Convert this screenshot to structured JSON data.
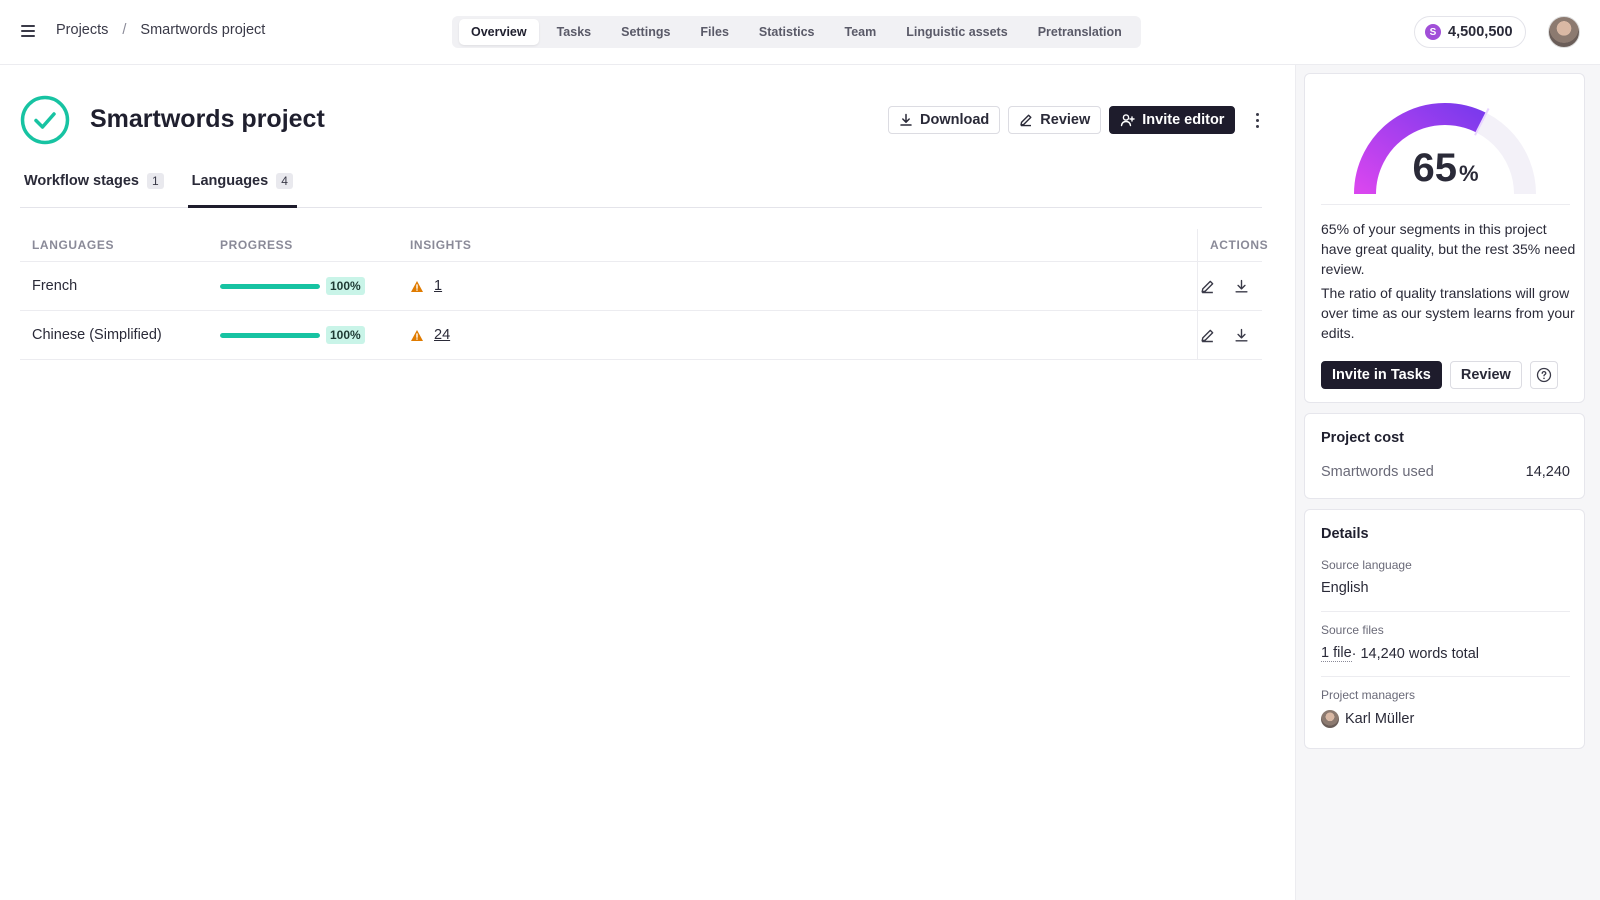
{
  "breadcrumb": {
    "root": "Projects",
    "separator": "/",
    "current": "Smartwords project"
  },
  "nav": {
    "tabs": [
      {
        "label": "Overview",
        "active": true
      },
      {
        "label": "Tasks"
      },
      {
        "label": "Settings"
      },
      {
        "label": "Files"
      },
      {
        "label": "Statistics"
      },
      {
        "label": "Team"
      },
      {
        "label": "Linguistic assets"
      },
      {
        "label": "Pretranslation"
      }
    ]
  },
  "balance": {
    "symbol": "S",
    "amount": "4,500,500"
  },
  "project": {
    "title": "Smartwords project",
    "status_icon": "check-circle-icon",
    "actions": {
      "download": "Download",
      "review": "Review",
      "invite": "Invite editor"
    }
  },
  "subtabs": [
    {
      "label": "Workflow stages",
      "count": "1"
    },
    {
      "label": "Languages",
      "count": "4",
      "active": true
    }
  ],
  "table": {
    "headers": {
      "languages": "LANGUAGES",
      "progress": "PROGRESS",
      "insights": "INSIGHTS",
      "actions": "ACTIONS"
    },
    "rows": [
      {
        "language": "French",
        "progress": 1.0,
        "progress_label": "100%",
        "insights": "1"
      },
      {
        "language": "Chinese (Simplified)",
        "progress": 1.0,
        "progress_label": "100%",
        "insights": "24"
      }
    ]
  },
  "quality": {
    "value": "65",
    "unit": "%",
    "fraction": 0.65,
    "text1": "65% of your segments in this project have great quality, but the rest 35% need review.",
    "text2": "The ratio of quality translations will grow over time as our system learns from your edits.",
    "invite_label": "Invite in Tasks",
    "review_label": "Review"
  },
  "cost": {
    "title": "Project cost",
    "label": "Smartwords used",
    "value": "14,240"
  },
  "details": {
    "title": "Details",
    "source_language_label": "Source language",
    "source_language": "English",
    "source_files_label": "Source files",
    "source_files_link": "1 file",
    "source_files_rest": " · 14,240 words total",
    "managers_label": "Project managers",
    "manager": "Karl Müller"
  },
  "colors": {
    "accent": "#17c3a2",
    "dark": "#1e1c2c",
    "gauge_start": "#d946ef",
    "gauge_end": "#7c3aed",
    "warning": "#e07b00"
  }
}
